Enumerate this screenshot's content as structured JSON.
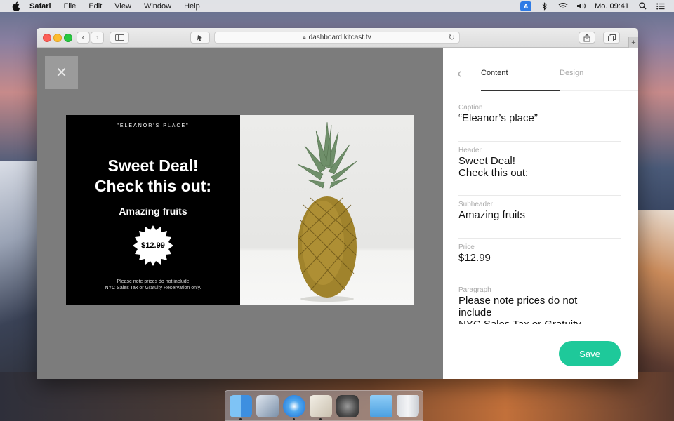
{
  "menubar": {
    "app_name": "Safari",
    "menus": [
      "File",
      "Edit",
      "View",
      "Window",
      "Help"
    ],
    "clock": "Mo. 09:41",
    "input_badge": "A"
  },
  "browser": {
    "url": "dashboard.kitcast.tv"
  },
  "preview": {
    "caption": "\"ELEANOR'S PLACE\"",
    "header_line1": "Sweet Deal!",
    "header_line2": "Check this out:",
    "subheader": "Amazing fruits",
    "price": "$12.99",
    "paragraph_line1": "Please note prices do not include",
    "paragraph_line2": "NYC Sales Tax or Gratuity Reservation only."
  },
  "panel": {
    "tabs": [
      {
        "label": "Content",
        "active": true
      },
      {
        "label": "Design",
        "active": false
      }
    ],
    "fields": [
      {
        "label": "Caption",
        "value": "“Eleanor’s place”"
      },
      {
        "label": "Header",
        "value_line1": "Sweet Deal!",
        "value_line2": "Check this out:"
      },
      {
        "label": "Subheader",
        "value": "Amazing fruits"
      },
      {
        "label": "Price",
        "value": "$12.99"
      },
      {
        "label": "Paragraph",
        "value_line1": "Please note prices do not",
        "value_line2": "include",
        "value_line3": "NYC Sales Tax or Gratuity"
      }
    ],
    "save_label": "Save"
  },
  "colors": {
    "accent": "#1ec99a",
    "preview_bg": "#000000"
  }
}
